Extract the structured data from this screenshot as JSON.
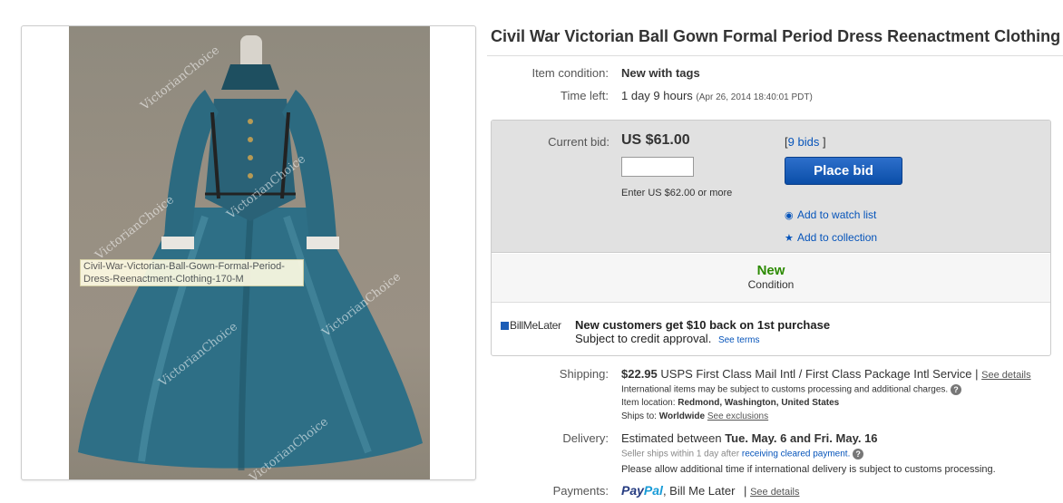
{
  "image": {
    "watermark": "VictorianChoice",
    "tooltip": "Civil-War-Victorian-Ball-Gown-Formal-Period-Dress-Reenactment-Clothing-170-M"
  },
  "listing": {
    "title": "Civil War Victorian Ball Gown Formal Period Dress Reenactment Clothing",
    "condition_label": "Item condition:",
    "condition_value": "New with tags",
    "time_label": "Time left:",
    "time_value": "1 day 9 hours",
    "time_detail": "(Apr 26, 2014   18:40:01 PDT)"
  },
  "bid": {
    "current_label": "Current bid:",
    "price": "US $61.00",
    "bids_open": "[",
    "bids_link": "9 bids",
    "bids_close": "]",
    "input_value": "",
    "hint": "Enter US $62.00 or more",
    "button": "Place bid",
    "watch": "Add to watch list",
    "collection": "Add to collection"
  },
  "condition_box": {
    "value": "New",
    "label": "Condition"
  },
  "billmelater": {
    "brand": "BillMeLater",
    "headline": "New customers get $10 back on 1st purchase",
    "sub": "Subject to credit approval.",
    "terms_link": "See terms"
  },
  "shipping": {
    "label": "Shipping:",
    "cost": "$22.95",
    "service": "USPS First Class Mail Intl / First Class Package Intl Service |",
    "details_link": "See details",
    "customs_note": "International items may be subject to customs processing and additional charges.",
    "location_label": "Item location:",
    "location_value": "Redmond, Washington, United States",
    "ships_to_label": "Ships to:",
    "ships_to_value": "Worldwide",
    "exclusions_link": "See exclusions"
  },
  "delivery": {
    "label": "Delivery:",
    "prefix": "Estimated between",
    "dates": "Tue. May. 6 and Fri. May. 16",
    "ships_within": "Seller ships within 1 day after",
    "cleared_link": "receiving cleared payment.",
    "intl_note": "Please allow additional time if international delivery is subject to customs processing."
  },
  "payments": {
    "label": "Payments:",
    "paypal_a": "Pay",
    "paypal_b": "Pal",
    "others": ", Bill Me Later",
    "sep": "|",
    "details_link": "See details"
  },
  "colors": {
    "link": "#0654ba",
    "button": "#0b4ea8",
    "new_green": "#2b8a00",
    "dress": "#2e6f86"
  },
  "icons": [
    "eye-icon",
    "star-icon",
    "help-icon",
    "checkbox-icon"
  ]
}
